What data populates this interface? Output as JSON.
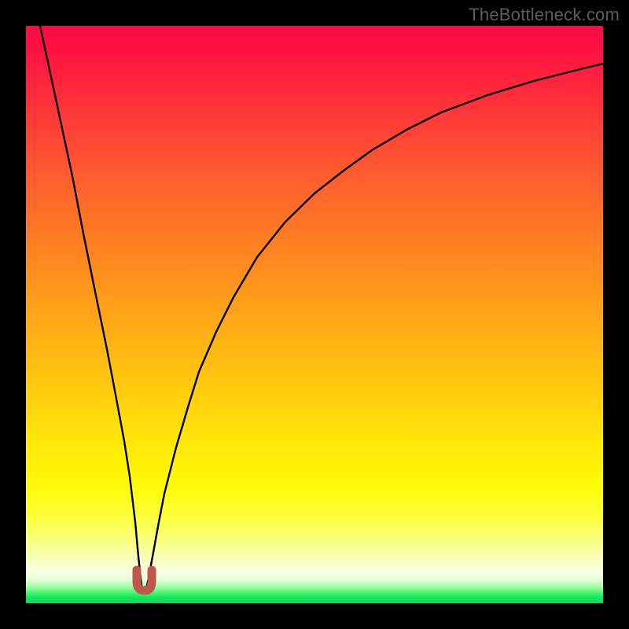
{
  "watermark": "TheBottleneck.com",
  "chart_data": {
    "type": "line",
    "title": "",
    "xlabel": "",
    "ylabel": "",
    "xlim": [
      0,
      100
    ],
    "ylim": [
      0,
      100
    ],
    "grid": false,
    "legend": false,
    "background": {
      "type": "vertical-gradient",
      "note": "red (high bottleneck) at top to green (low bottleneck) at bottom",
      "stops": [
        {
          "pos": 0,
          "color": "#ff0b46"
        },
        {
          "pos": 50,
          "color": "#ffa518"
        },
        {
          "pos": 80,
          "color": "#fffb08"
        },
        {
          "pos": 100,
          "color": "#0add54"
        }
      ]
    },
    "series": [
      {
        "name": "bottleneck-curve",
        "color": "#000000",
        "x": [
          2.5,
          4,
          6,
          8,
          10,
          12,
          14,
          16,
          17,
          18,
          19,
          19.5,
          20,
          20.5,
          21,
          22,
          23,
          24,
          26,
          28,
          30,
          33,
          36,
          40,
          45,
          50,
          55,
          60,
          66,
          72,
          80,
          88,
          96,
          100
        ],
        "y": [
          100,
          93,
          83.5,
          74,
          64,
          54,
          44,
          34,
          28,
          22,
          14,
          8,
          3,
          2.5,
          3,
          8,
          14,
          19,
          27,
          34,
          40,
          47,
          53,
          60,
          66,
          71,
          75,
          78.5,
          82,
          85,
          88,
          90.5,
          92.5,
          93.5
        ]
      },
      {
        "name": "minimum-marker",
        "type": "marker",
        "color": "#c1564f",
        "shape": "u",
        "x_range": [
          19.3,
          21.2
        ],
        "y_range": [
          2.0,
          5.8
        ]
      }
    ],
    "notes": "V-shaped bottleneck curve. Left limb drops steeply and nearly linearly from ~100 at x≈2.5 to the minimum (~2.5) near x≈20. Right limb rises with decreasing slope toward ~93.5 at x=100. A small salmon-colored U-shaped marker highlights the minimum region."
  }
}
